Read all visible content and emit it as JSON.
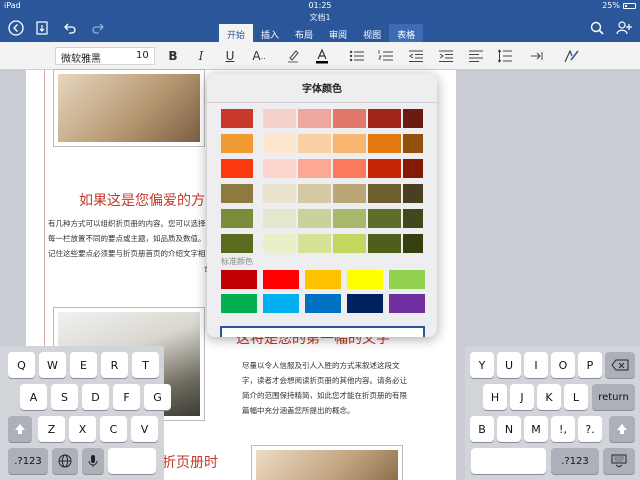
{
  "status": {
    "carrier": "iPad",
    "time": "01:25",
    "battery": "25%"
  },
  "title": "文档1",
  "tabs": [
    "开始",
    "插入",
    "布局",
    "审阅",
    "视图",
    "表格"
  ],
  "ribbon": {
    "font_name": "微软雅黑",
    "font_size": "10",
    "bold": "B",
    "italic": "I",
    "underline": "U",
    "text_effects": "A"
  },
  "document": {
    "heading1": "如果这是您偏爱的方",
    "heading2": "这将是您的第一幅的文字",
    "heading3": "折页册时",
    "para1": [
      "有几种方式可以组织折页册的内容。您可以选择",
      "每一栏放置不同的要点或主题，如品质及数值。",
      "记住这些要点必须要与折页册首页的介绍文字相"
    ],
    "para1_tail": "合",
    "para2": [
      "尽量以令人信服及引人入胜的方式来叙述这段文",
      "字，读者才会想阅读折页册的其他内容。请务必让",
      "简介的范围保持精简，如此您才能在折页册的有限",
      "篇幅中充分涵盖您所提出的概念。"
    ]
  },
  "popover": {
    "title": "字体颜色",
    "standard_label": "标准颜色",
    "theme_rows": [
      [
        "#c8392b",
        "#f6d0cb",
        "#efa69e",
        "#e2786c",
        "#a02519",
        "#6d1a12"
      ],
      [
        "#f29a32",
        "#fde7cf",
        "#fbd0a3",
        "#f7b771",
        "#e07a10",
        "#93500c"
      ],
      [
        "#fb3a10",
        "#fdd5cc",
        "#fca895",
        "#fa7a5b",
        "#c72606",
        "#841a04"
      ],
      [
        "#8c7a3f",
        "#e8e2cf",
        "#d4c9a3",
        "#b9a876",
        "#6e5f30",
        "#4a3f20"
      ],
      [
        "#7a8c3a",
        "#e3e8cd",
        "#c8d39c",
        "#a6b86a",
        "#5e6d2c",
        "#3f491d"
      ],
      [
        "#5a6b1f",
        "#e9f0c7",
        "#d5e398",
        "#c2d660",
        "#4f5f1b",
        "#354012"
      ]
    ],
    "standard_colors": [
      "#c00000",
      "#ff0000",
      "#ffc000",
      "#ffff00",
      "#92d050",
      "#00b050",
      "#00b0f0",
      "#0070c0",
      "#002060",
      "#7030a0"
    ]
  },
  "keyboard": {
    "left": [
      [
        "Q",
        "W",
        "E",
        "R",
        "T"
      ],
      [
        "A",
        "S",
        "D",
        "F",
        "G"
      ],
      [
        "Z",
        "X",
        "C",
        "V"
      ]
    ],
    "left_bottom": ".?123",
    "right": [
      [
        "Y",
        "U",
        "I",
        "O",
        "P"
      ],
      [
        "H",
        "J",
        "K",
        "L"
      ],
      [
        "B",
        "N",
        "M",
        "!,",
        "?."
      ]
    ],
    "return": "return",
    "right_bottom": ".?123"
  }
}
